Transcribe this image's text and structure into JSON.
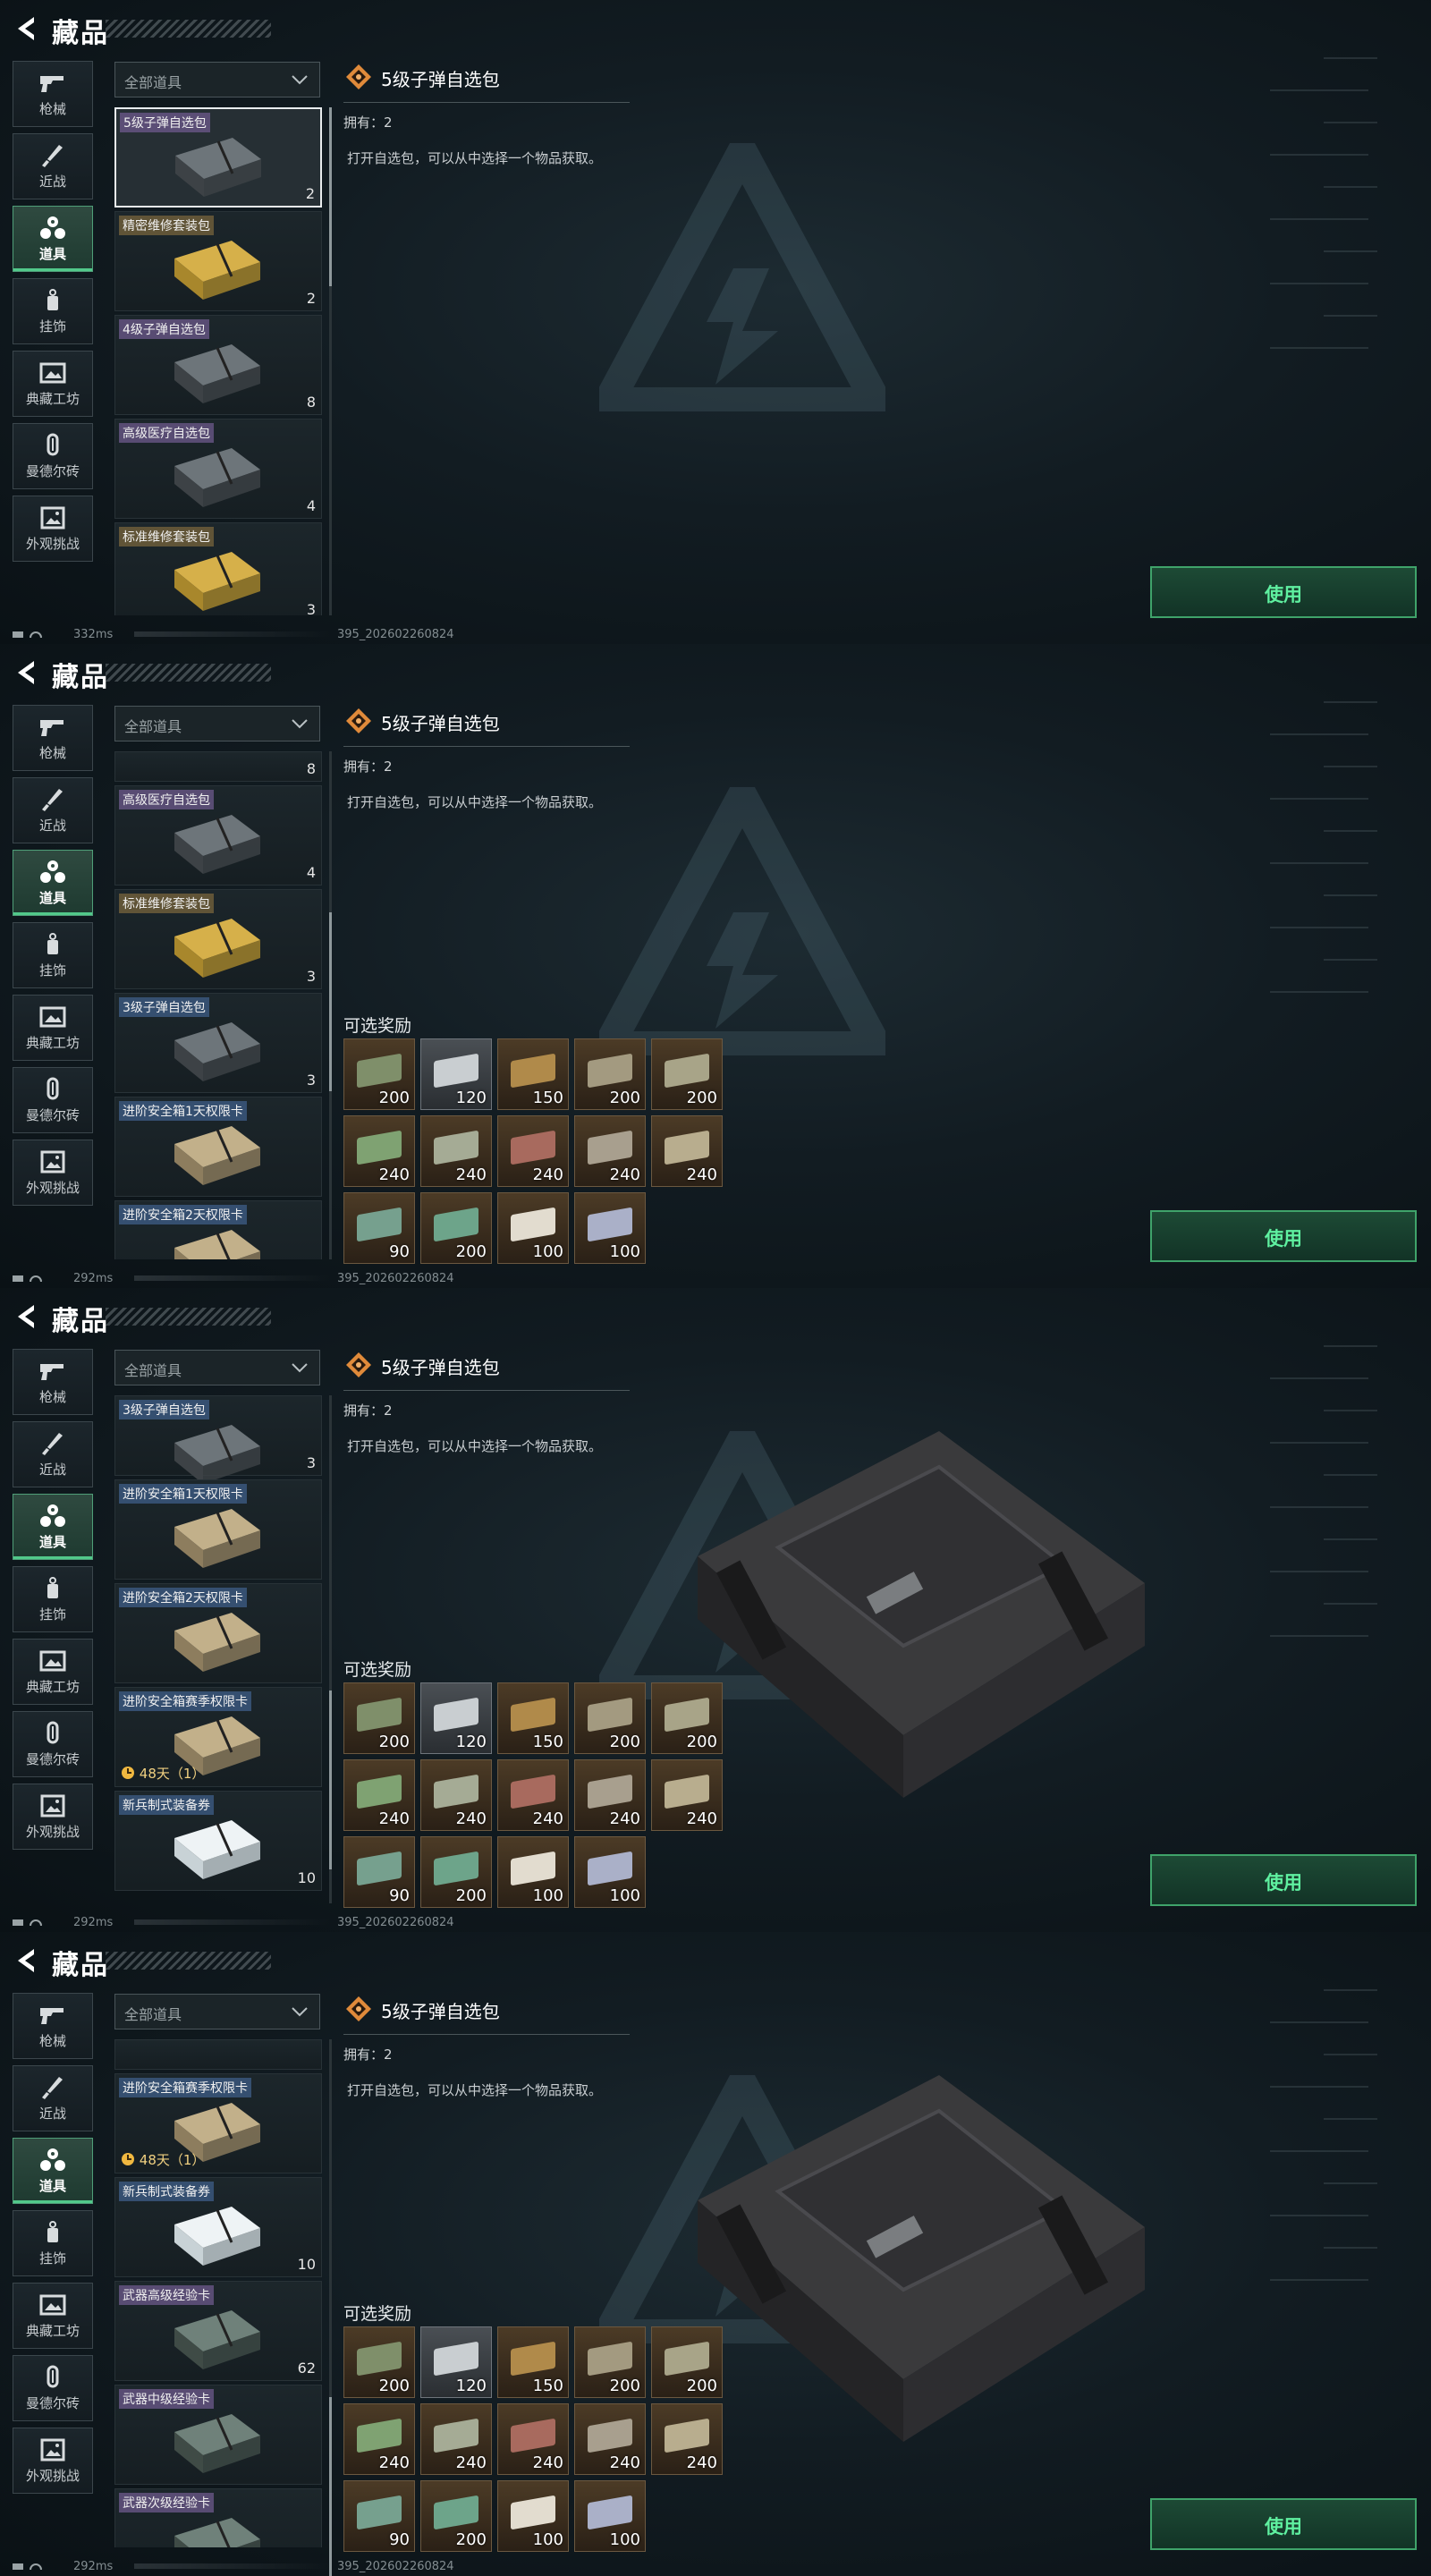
{
  "header": {
    "title": "藏品"
  },
  "categories": [
    "枪械",
    "近战",
    "道具",
    "挂饰",
    "典藏工坊",
    "曼德尔砖",
    "外观挑战"
  ],
  "filter": {
    "selected": "全部道具"
  },
  "detail": {
    "name": "5级子弹自选包",
    "owned": "拥有：2",
    "description": "打开自选包，可以从中选择一个物品获取。",
    "rewards_title": "可选奖励",
    "use_label": "使用"
  },
  "rewards": [
    "200",
    "120",
    "150",
    "200",
    "200",
    "240",
    "240",
    "240",
    "240",
    "240",
    "90",
    "200",
    "100",
    "100"
  ],
  "status": {
    "ping1": "332ms",
    "ping2": "292ms",
    "version": "395_202602260824"
  },
  "frames": [
    {
      "items": [
        {
          "name": "5级子弹自选包",
          "count": "2"
        },
        {
          "name": "精密维修套装包",
          "count": "2"
        },
        {
          "name": "4级子弹自选包",
          "count": "8"
        },
        {
          "name": "高级医疗自选包",
          "count": "4"
        },
        {
          "name": "标准维修套装包",
          "count": "3"
        }
      ]
    },
    {
      "items": [
        {
          "name": "",
          "count": "8"
        },
        {
          "name": "高级医疗自选包",
          "count": "4"
        },
        {
          "name": "标准维修套装包",
          "count": "3"
        },
        {
          "name": "3级子弹自选包",
          "count": "3"
        },
        {
          "name": "进阶安全箱1天权限卡",
          "count": ""
        },
        {
          "name": "进阶安全箱2天权限卡",
          "count": ""
        }
      ]
    },
    {
      "items": [
        {
          "name": "3级子弹自选包",
          "count": "3"
        },
        {
          "name": "进阶安全箱1天权限卡",
          "count": ""
        },
        {
          "name": "进阶安全箱2天权限卡",
          "count": ""
        },
        {
          "name": "进阶安全箱赛季权限卡",
          "count": "",
          "timer": "48天（1）"
        },
        {
          "name": "新兵制式装备券",
          "count": "10"
        }
      ]
    },
    {
      "items": [
        {
          "name": "",
          "count": ""
        },
        {
          "name": "进阶安全箱赛季权限卡",
          "count": "",
          "timer": "48天（1）"
        },
        {
          "name": "新兵制式装备券",
          "count": "10"
        },
        {
          "name": "武器高级经验卡",
          "count": "62"
        },
        {
          "name": "武器中级经验卡",
          "count": ""
        },
        {
          "name": "武器次级经验卡",
          "count": ""
        }
      ]
    }
  ],
  "colors": {
    "accent": "#52c98a",
    "use_text": "#5ff0a0"
  }
}
